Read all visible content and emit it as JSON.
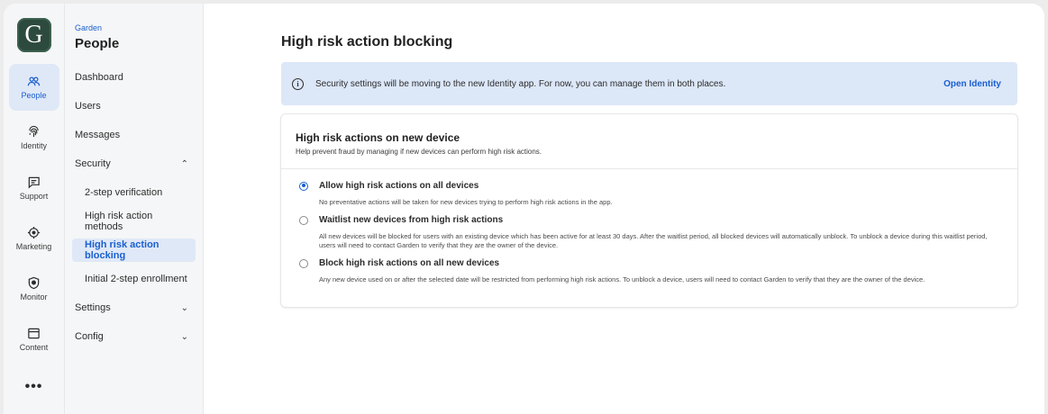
{
  "rail": {
    "logo_letter": "G",
    "items": [
      {
        "label": "People",
        "icon": "people-icon",
        "active": true
      },
      {
        "label": "Identity",
        "icon": "fingerprint-icon",
        "active": false
      },
      {
        "label": "Support",
        "icon": "chat-icon",
        "active": false
      },
      {
        "label": "Marketing",
        "icon": "target-icon",
        "active": false
      },
      {
        "label": "Monitor",
        "icon": "shield-icon",
        "active": false
      },
      {
        "label": "Content",
        "icon": "window-icon",
        "active": false
      }
    ],
    "more_label": "•••"
  },
  "nav": {
    "org": "Garden",
    "title": "People",
    "items": [
      {
        "label": "Dashboard"
      },
      {
        "label": "Users"
      },
      {
        "label": "Messages"
      },
      {
        "label": "Security",
        "chevron": "⌃"
      },
      {
        "label": "2-step verification"
      },
      {
        "label": "High risk action methods"
      },
      {
        "label": "High risk action blocking"
      },
      {
        "label": "Initial 2-step enrollment"
      },
      {
        "label": "Settings",
        "chevron": "⌄"
      },
      {
        "label": "Config",
        "chevron": "⌄"
      }
    ]
  },
  "main": {
    "title": "High risk action blocking",
    "banner": {
      "icon": "info-icon",
      "icon_glyph": "i",
      "text": "Security settings will be moving to the new Identity app. For now, you can manage them in both places.",
      "link": "Open Identity"
    },
    "card": {
      "title": "High risk actions on new device",
      "subtitle": "Help prevent fraud by managing if new devices can perform high risk actions.",
      "options": [
        {
          "label": "Allow high risk actions on all devices",
          "desc": "No preventative actions will be taken for new devices trying to perform high risk actions in the app.",
          "checked": true
        },
        {
          "label": "Waitlist new devices from high risk actions",
          "desc": "All new devices will be blocked for users with an existing device which has been active for at least 30 days. After the waitlist period, all blocked devices will automatically unblock. To unblock a device during this waitlist period, users will need to contact Garden to verify that they are the owner of the device.",
          "checked": false
        },
        {
          "label": "Block high risk actions on all new devices",
          "desc": "Any new device used on or after the selected date will be restricted from performing high risk actions. To unblock a device, users will need to contact Garden to verify that they are the owner of the device.",
          "checked": false
        }
      ]
    }
  },
  "colors": {
    "accent": "#1a5fd0",
    "active_bg": "#dfe8f7",
    "banner_bg": "#dce7f8"
  }
}
